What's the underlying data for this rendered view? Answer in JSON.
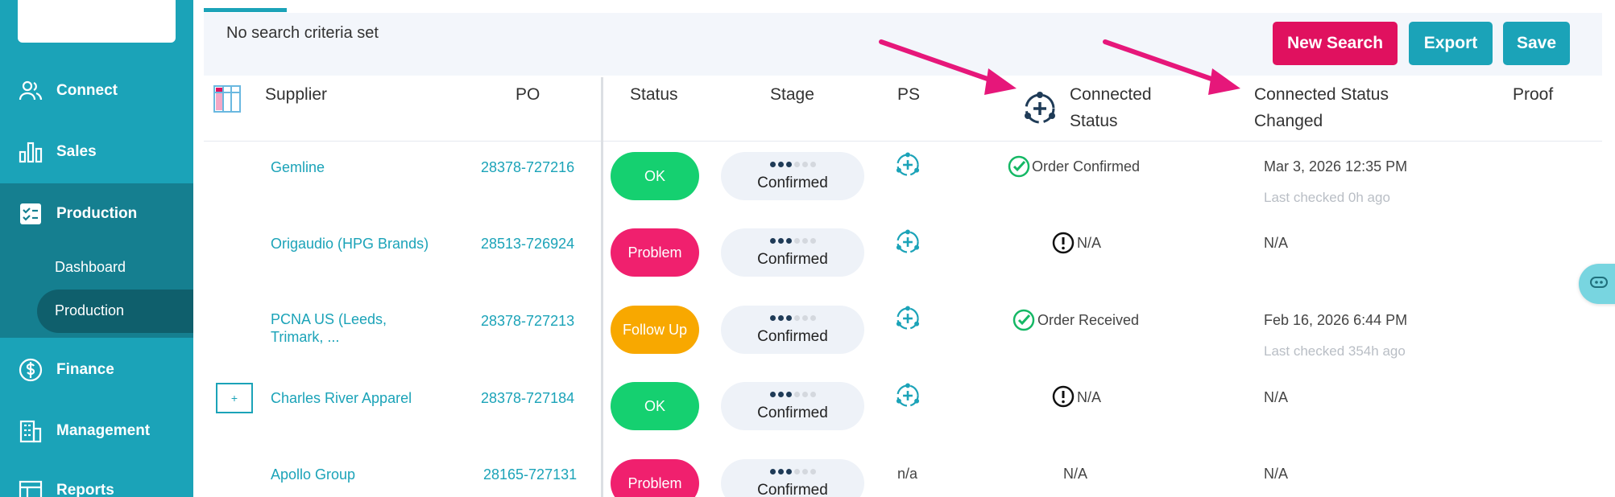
{
  "sidebar": {
    "items": [
      {
        "label": "Connect",
        "icon": "users-icon"
      },
      {
        "label": "Sales",
        "icon": "bar-chart-icon"
      },
      {
        "label": "Production",
        "icon": "checklist-icon"
      },
      {
        "label": "Finance",
        "icon": "dollar-icon"
      },
      {
        "label": "Management",
        "icon": "building-icon"
      },
      {
        "label": "Reports",
        "icon": "table-icon"
      }
    ],
    "production_sub": [
      "Dashboard",
      "Production"
    ]
  },
  "toolbar": {
    "criteria": "No search criteria set",
    "new_search": "New Search",
    "export": "Export",
    "save": "Save"
  },
  "table": {
    "headers": {
      "supplier": "Supplier",
      "po": "PO",
      "status": "Status",
      "stage": "Stage",
      "ps": "PS",
      "connected_status_1": "Connected",
      "connected_status_2": "Status",
      "changed_1": "Connected Status",
      "changed_2": "Changed",
      "proof": "Proof"
    },
    "rows": [
      {
        "supplier": "Gemline",
        "po": "28378-727216",
        "status": "OK",
        "stage": "Confirmed",
        "ps": "",
        "connected": "Order Confirmed",
        "changed": "Mar 3, 2026 12:35 PM",
        "checked": "Last checked 0h ago"
      },
      {
        "supplier": "Origaudio (HPG Brands)",
        "po": "28513-726924",
        "status": "Problem",
        "stage": "Confirmed",
        "ps": "",
        "connected": "N/A",
        "changed": "N/A",
        "checked": ""
      },
      {
        "supplier": "PCNA US (Leeds, Trimark, ...",
        "supplier_line1": "PCNA US (Leeds,",
        "supplier_line2": "Trimark, ...",
        "po": "28378-727213",
        "status": "Follow Up",
        "stage": "Confirmed",
        "ps": "",
        "connected": "Order Received",
        "changed": "Feb 16, 2026 6:44 PM",
        "checked": "Last checked 354h ago"
      },
      {
        "supplier": "Charles River Apparel",
        "po": "28378-727184",
        "status": "OK",
        "stage": "Confirmed",
        "ps": "",
        "connected": "N/A",
        "changed": "N/A",
        "checked": "",
        "expand": "+"
      },
      {
        "supplier": "Apollo Group",
        "po": "28165-727131",
        "status": "Problem",
        "stage": "Confirmed",
        "ps": "n/a",
        "connected": "N/A",
        "changed": "N/A",
        "checked": ""
      }
    ]
  },
  "colors": {
    "sidebar": "#1ba3b8",
    "sidebar_active": "#157f90",
    "accent_pink": "#e0115f",
    "ok_green": "#15d070",
    "follow_orange": "#f8a800",
    "link": "#1ba3b8",
    "arrow": "#e6177a"
  }
}
